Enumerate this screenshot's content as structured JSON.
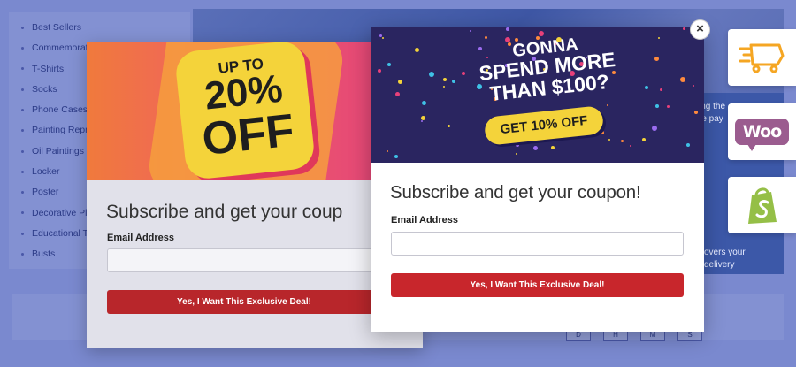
{
  "sidebar": {
    "items": [
      {
        "label": "Best Sellers"
      },
      {
        "label": "Commemorative"
      },
      {
        "label": "T-Shirts"
      },
      {
        "label": "Socks"
      },
      {
        "label": "Phone Cases"
      },
      {
        "label": "Painting Reprod"
      },
      {
        "label": "Oil Paintings"
      },
      {
        "label": "Locker"
      },
      {
        "label": "Poster"
      },
      {
        "label": "Decorative Plat"
      },
      {
        "label": "Educational Toy"
      },
      {
        "label": "Busts"
      }
    ]
  },
  "hero": {
    "line1": "ing the",
    "line2": "re pay",
    "line3": "overs your",
    "line4": "delivery"
  },
  "keys": [
    "D",
    "H",
    "M",
    "S"
  ],
  "apps": [
    {
      "icon": "delivery-truck-icon",
      "color": "#f5a623"
    },
    {
      "icon": "woocommerce-icon",
      "label": "Woo",
      "color": "#9b5c8f"
    },
    {
      "icon": "shopify-icon",
      "color": "#95bf47"
    }
  ],
  "popup_back": {
    "banner_line1": "UP TO",
    "banner_line2": "20%",
    "banner_line3": "OFF",
    "title": "Subscribe and get your coup",
    "email_label": "Email Address",
    "button_label": "Yes, I Want This Exclusive Deal!"
  },
  "popup_front": {
    "banner_line1": "GONNA",
    "banner_line2": "SPEND MORE",
    "banner_line3": "THAN $100?",
    "banner_cta": "GET 10% OFF",
    "title": "Subscribe and get your coupon!",
    "email_label": "Email Address",
    "button_label": "Yes, I Want This Exclusive Deal!",
    "close_label": "×"
  },
  "colors": {
    "accent_red": "#c8262c",
    "banner_yellow": "#f4d33a",
    "banner_navy": "#2a2560"
  }
}
